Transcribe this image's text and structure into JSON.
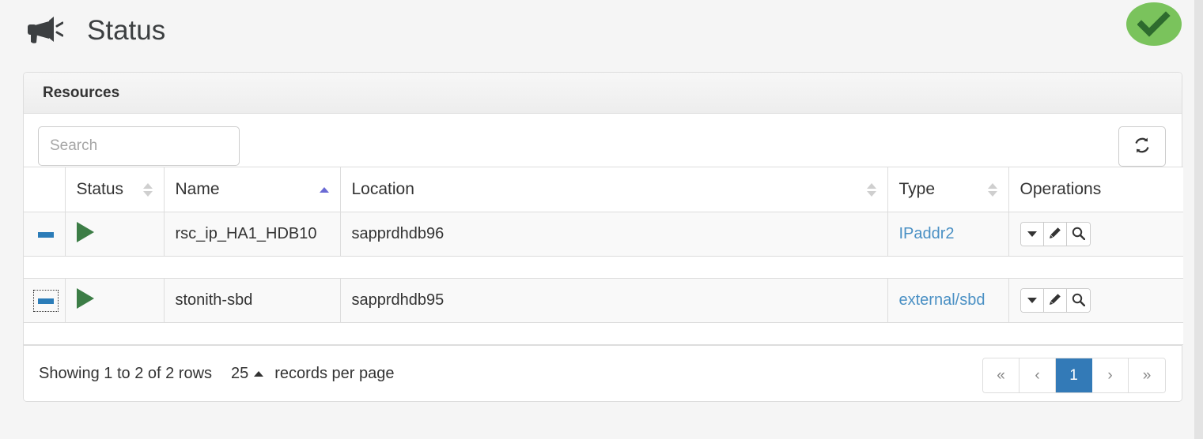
{
  "header": {
    "icon": "bullhorn-icon",
    "title": "Status",
    "status_badge": {
      "icon": "check-icon",
      "color": "#7ac35c",
      "check_color": "#2e6b2e"
    }
  },
  "panel": {
    "title": "Resources"
  },
  "toolbar": {
    "search": {
      "placeholder": "Search",
      "value": ""
    },
    "refresh": {
      "icon": "refresh-icon",
      "label": ""
    }
  },
  "table": {
    "columns": [
      {
        "key": "toggle",
        "label": "",
        "sortable": false,
        "sort": "none"
      },
      {
        "key": "status",
        "label": "Status",
        "sortable": true,
        "sort": "none"
      },
      {
        "key": "name",
        "label": "Name",
        "sortable": true,
        "sort": "asc"
      },
      {
        "key": "location",
        "label": "Location",
        "sortable": true,
        "sort": "none"
      },
      {
        "key": "type",
        "label": "Type",
        "sortable": true,
        "sort": "none"
      },
      {
        "key": "operations",
        "label": "Operations",
        "sortable": false,
        "sort": "none"
      }
    ],
    "rows": [
      {
        "toggle_icon": "minus-icon",
        "toggle_focused": false,
        "status_icon": "play-icon",
        "name": "rsc_ip_HA1_HDB10",
        "location": "sapprdhdb96",
        "type": "IPaddr2",
        "operations": [
          "caret-down-icon",
          "pencil-icon",
          "search-icon"
        ]
      },
      {
        "toggle_icon": "minus-icon",
        "toggle_focused": true,
        "status_icon": "play-icon",
        "name": "stonith-sbd",
        "location": "sapprdhdb95",
        "type": "external/sbd",
        "operations": [
          "caret-down-icon",
          "pencil-icon",
          "search-icon"
        ]
      }
    ]
  },
  "footer": {
    "showing_text": "Showing 1 to 2 of 2 rows",
    "page_size": "25",
    "records_per_page_label": "records per page",
    "pagination": [
      {
        "label": "«",
        "name": "first",
        "active": false
      },
      {
        "label": "‹",
        "name": "previous",
        "active": false
      },
      {
        "label": "1",
        "name": "page-1",
        "active": true
      },
      {
        "label": "›",
        "name": "next",
        "active": false
      },
      {
        "label": "»",
        "name": "last",
        "active": false
      }
    ]
  },
  "colors": {
    "accent_blue": "#337ab7",
    "link_blue": "#4a90c4",
    "status_green": "#3c7d46",
    "badge_green": "#7ac35c",
    "sort_active": "#6a6ad4"
  }
}
